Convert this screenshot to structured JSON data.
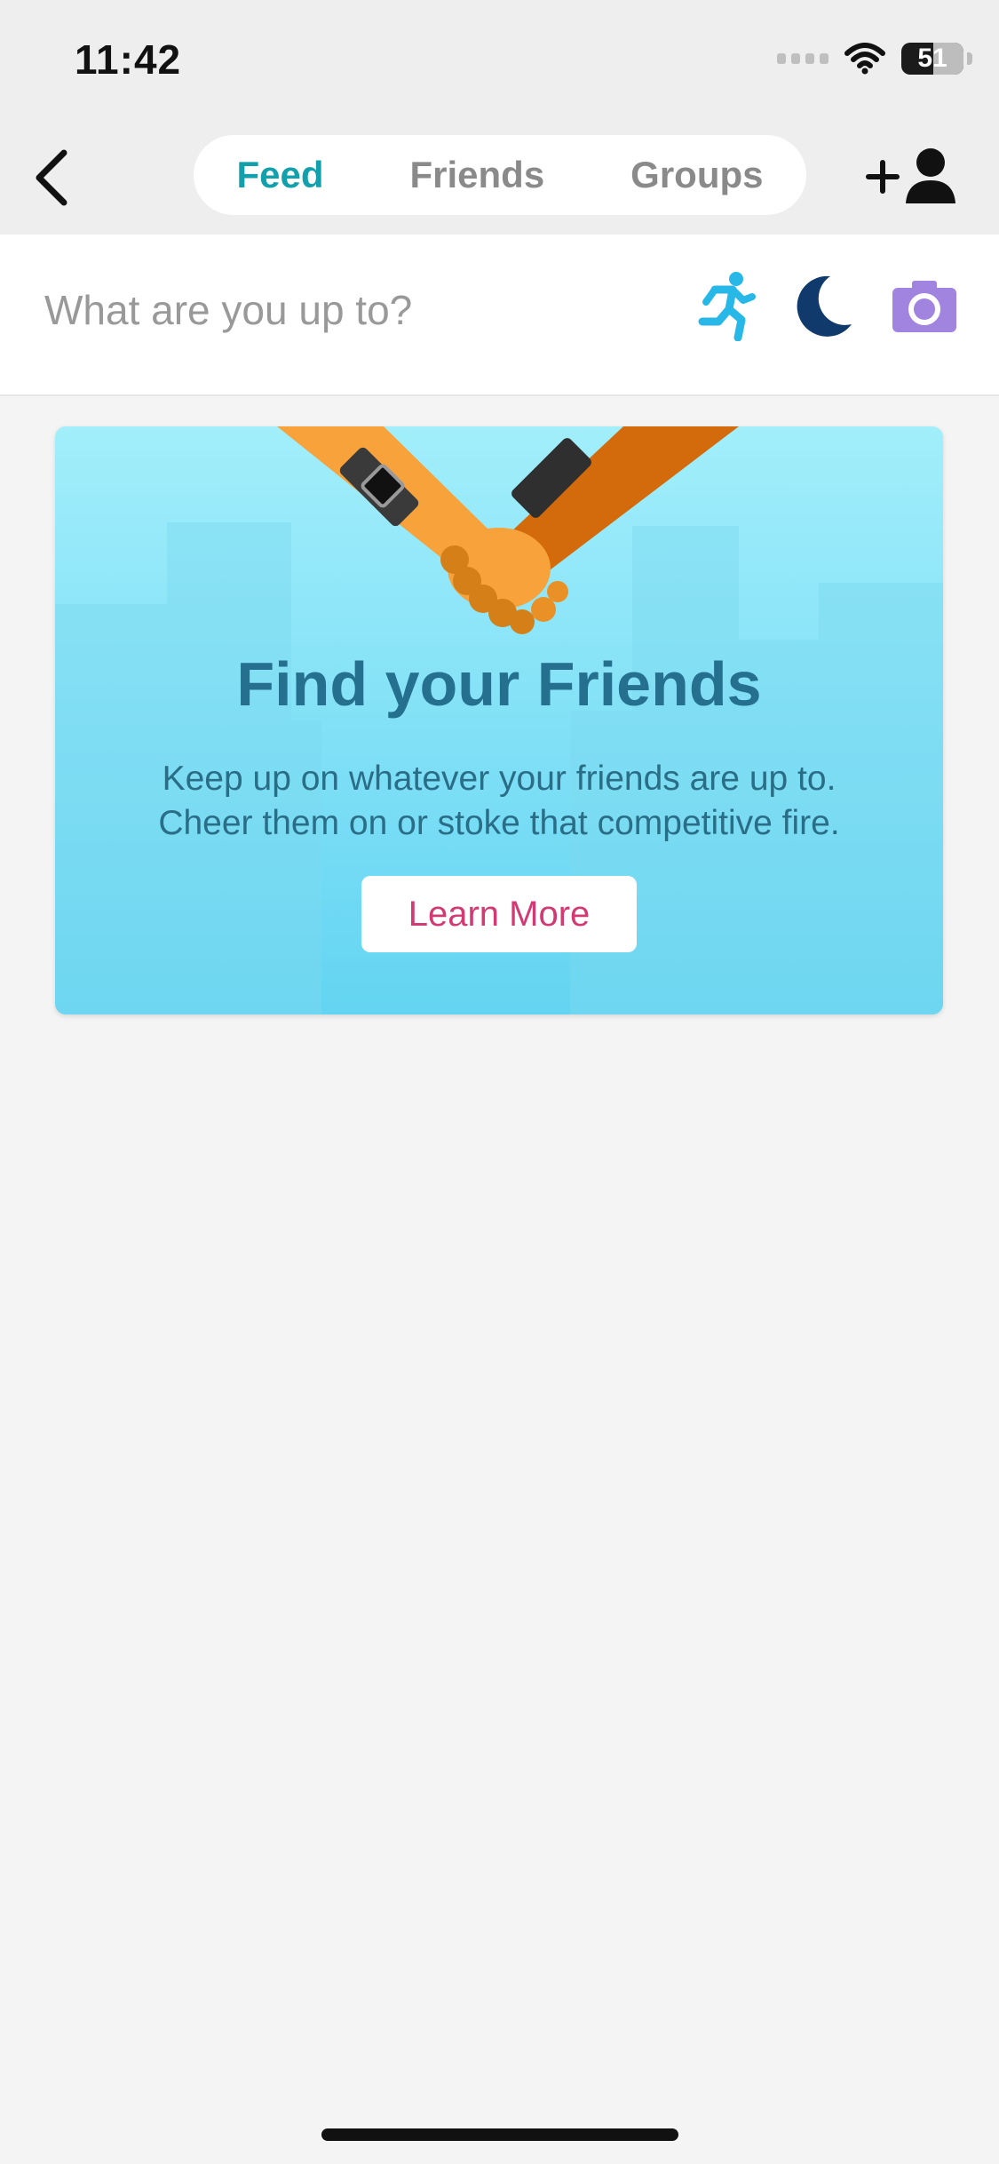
{
  "status_bar": {
    "time": "11:42",
    "battery_level": "51"
  },
  "header": {
    "tabs": [
      {
        "label": "Feed",
        "active": true
      },
      {
        "label": "Friends",
        "active": false
      },
      {
        "label": "Groups",
        "active": false
      }
    ]
  },
  "composer": {
    "placeholder": "What are you up to?",
    "icons": [
      "running-icon",
      "moon-icon",
      "camera-icon"
    ]
  },
  "promo": {
    "title": "Find your Friends",
    "body_line1": "Keep up on whatever your friends are up to.",
    "body_line2": "Cheer them on or stoke that competitive fire.",
    "button_label": "Learn More"
  },
  "colors": {
    "accent": "#13a0ad",
    "run_icon": "#28b8e8",
    "moon_icon": "#0f3a6b",
    "camera_icon": "#a183e0",
    "button_text": "#d13a73"
  }
}
